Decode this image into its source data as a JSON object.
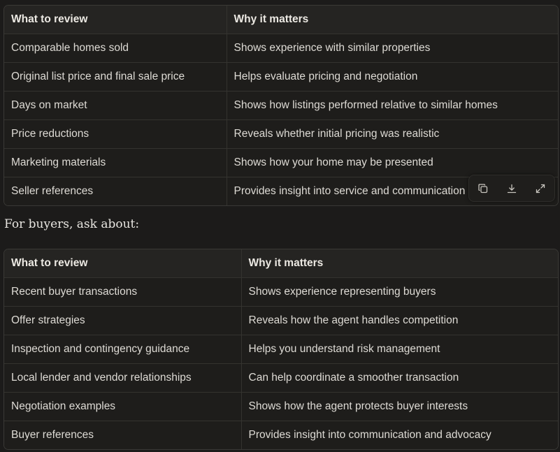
{
  "seller_table": {
    "headers": [
      "What to review",
      "Why it matters"
    ],
    "rows": [
      [
        "Comparable homes sold",
        "Shows experience with similar properties"
      ],
      [
        "Original list price and final sale price",
        "Helps evaluate pricing and negotiation"
      ],
      [
        "Days on market",
        "Shows how listings performed relative to similar homes"
      ],
      [
        "Price reductions",
        "Reveals whether initial pricing was realistic"
      ],
      [
        "Marketing materials",
        "Shows how your home may be presented"
      ],
      [
        "Seller references",
        "Provides insight into service and communication"
      ]
    ]
  },
  "intro_text": "For buyers, ask about:",
  "buyer_table": {
    "headers": [
      "What to review",
      "Why it matters"
    ],
    "rows": [
      [
        "Recent buyer transactions",
        "Shows experience representing buyers"
      ],
      [
        "Offer strategies",
        "Reveals how the agent handles competition"
      ],
      [
        "Inspection and contingency guidance",
        "Helps you understand risk management"
      ],
      [
        "Local lender and vendor relationships",
        "Can help coordinate a smoother transaction"
      ],
      [
        "Negotiation examples",
        "Shows how the agent protects buyer interests"
      ],
      [
        "Buyer references",
        "Provides insight into communication and advocacy"
      ]
    ]
  },
  "toolbar": {
    "icons": [
      "copy-icon",
      "download-icon",
      "expand-icon"
    ]
  }
}
